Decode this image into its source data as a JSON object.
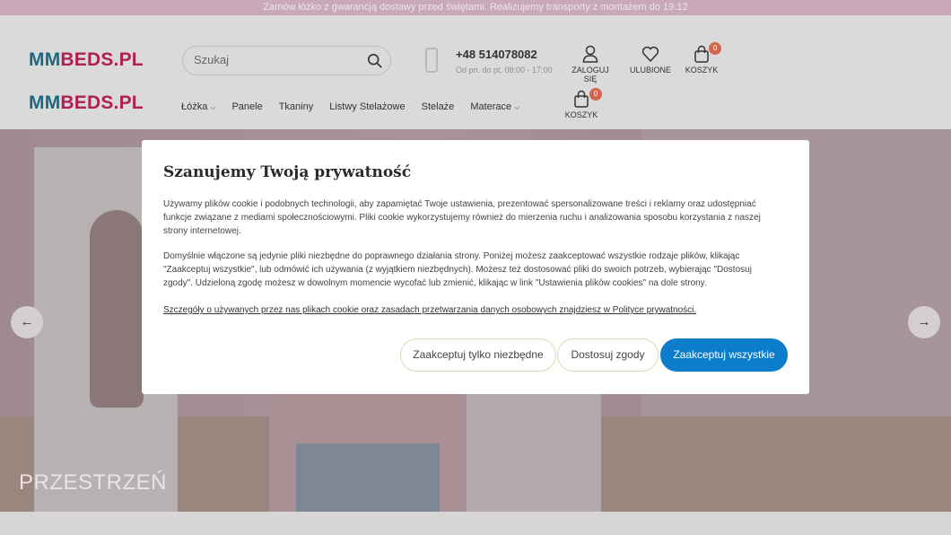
{
  "promo_bar": {
    "text": "Zamów łóżko z gwarancją dostawy przed świętami. Realizujemy transporty z montażem do 19.12"
  },
  "header": {
    "logo": {
      "mm": "MM",
      "beds": "BEDS.PL"
    },
    "search": {
      "placeholder": "Szukaj"
    },
    "phone": {
      "number": "+48 514078082",
      "hours": "Od pn. do pt. 08:00 - 17:00"
    },
    "account_label": "ZALOGUJ SIĘ",
    "favorites_label": "ULUBIONE",
    "cart_label": "KOSZYK",
    "cart_count": "0",
    "nav": [
      {
        "label": "Łóżka",
        "dropdown": true
      },
      {
        "label": "Panele",
        "dropdown": false
      },
      {
        "label": "Tkaniny",
        "dropdown": false
      },
      {
        "label": "Listwy Stelażowe",
        "dropdown": false
      },
      {
        "label": "Stelaże",
        "dropdown": false
      },
      {
        "label": "Materace",
        "dropdown": true
      }
    ],
    "cart2_label": "KOSZYK",
    "cart2_count": "0"
  },
  "hero": {
    "caption": "PRZESTRZEŃ",
    "prev_icon": "arrow-left-icon",
    "next_icon": "arrow-right-icon"
  },
  "cookie_modal": {
    "title": "Szanujemy Twoją prywatność",
    "paragraph1": "Używamy plików cookie i podobnych technologii, aby zapamiętać Twoje ustawienia, prezentować spersonalizowane treści i reklamy oraz udostępniać funkcje związane z mediami społecznościowymi. Pliki cookie wykorzystujemy również do mierzenia ruchu i analizowania sposobu korzystania z naszej strony internetowej.",
    "paragraph2": "Domyślnie włączone są jedynie pliki niezbędne do poprawnego działania strony. Poniżej możesz zaakceptować wszystkie rodzaje plików, klikając \"Zaakceptuj wszystkie\", lub odmówić ich używania (z wyjątkiem niezbędnych). Możesz też dostosować pliki do swoich potrzeb, wybierając \"Dostosuj zgody\". Udzieloną zgodę możesz w dowolnym momencie wycofać lub zmienić, klikając w link \"Ustawienia plików cookies\" na dole strony.",
    "policy_link": "Szczegóły o używanych przez nas plikach cookie oraz zasadach przetwarzania danych osobowych znajdziesz w Polityce prywatności.",
    "buttons": {
      "necessary": "Zaakceptuj tylko niezbędne",
      "customize": "Dostosuj zgody",
      "accept_all": "Zaakceptuj wszystkie"
    },
    "accent_color": "#0c7dcb"
  }
}
